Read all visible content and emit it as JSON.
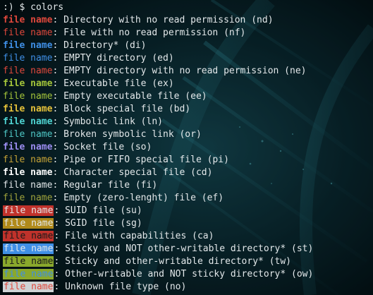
{
  "prompt": {
    "symbol": ":)",
    "dollar": "$",
    "command": "colors"
  },
  "entries": [
    {
      "name": "file name",
      "sep": ":",
      "desc": " Directory with no read permission (nd)",
      "fg": "#e0483c",
      "bg": "",
      "bold": true
    },
    {
      "name": "file name",
      "sep": ":",
      "desc": " File with no read permission (nf)",
      "fg": "#e0483c",
      "bg": "",
      "bold": false
    },
    {
      "name": "file name",
      "sep": ":",
      "desc": " Directory* (di)",
      "fg": "#3f8fe6",
      "bg": "",
      "bold": true
    },
    {
      "name": "file name",
      "sep": ":",
      "desc": " EMPTY directory (ed)",
      "fg": "#3f8fe6",
      "bg": "",
      "bold": false
    },
    {
      "name": "file name",
      "sep": ":",
      "desc": " EMPTY directory with no read permission (ne)",
      "fg": "#e0483c",
      "bg": "",
      "bold": false
    },
    {
      "name": "file name",
      "sep": ":",
      "desc": " Executable file (ex)",
      "fg": "#a4c53a",
      "bg": "",
      "bold": true
    },
    {
      "name": "file name",
      "sep": ":",
      "desc": " Empty executable file (ee)",
      "fg": "#a4c53a",
      "bg": "",
      "bold": false
    },
    {
      "name": "file name",
      "sep": ":",
      "desc": " Block special file (bd)",
      "fg": "#e6c23a",
      "bg": "",
      "bold": true
    },
    {
      "name": "file name",
      "sep": ":",
      "desc": " Symbolic link (ln)",
      "fg": "#4fd4d2",
      "bg": "",
      "bold": true
    },
    {
      "name": "file name",
      "sep": ":",
      "desc": " Broken symbolic link (or)",
      "fg": "#4fc8c6",
      "bg": "",
      "bold": false
    },
    {
      "name": "file name",
      "sep": ":",
      "desc": " Socket file (so)",
      "fg": "#9c8ef2",
      "bg": "",
      "bold": true
    },
    {
      "name": "file name",
      "sep": ":",
      "desc": " Pipe or FIFO special file (pi)",
      "fg": "#c7a437",
      "bg": "",
      "bold": false
    },
    {
      "name": "file name",
      "sep": ":",
      "desc": " Character special file (cd)",
      "fg": "#ffffff",
      "bg": "",
      "bold": true
    },
    {
      "name": "file name",
      "sep": ":",
      "desc": " Regular file (fi)",
      "fg": "#e3e8ea",
      "bg": "",
      "bold": false
    },
    {
      "name": "file name",
      "sep": ":",
      "desc": " Empty (zero-lenght) file (ef)",
      "fg": "#a0a43c",
      "bg": "",
      "bold": false
    },
    {
      "name": "file name",
      "sep": ":",
      "desc": " SUID file (su)",
      "fg": "#e3e8ea",
      "bg": "#c0322b",
      "bold": false
    },
    {
      "name": "file name",
      "sep": ":",
      "desc": " SGID file (sg)",
      "fg": "#e3e8ea",
      "bg": "#b08a1a",
      "bold": false
    },
    {
      "name": "file name",
      "sep": ":",
      "desc": " File with capabilities (ca)",
      "fg": "#1a1a1a",
      "bg": "#c0322b",
      "bold": false
    },
    {
      "name": "file name",
      "sep": ":",
      "desc": " Sticky and NOT other-writable directory* (st)",
      "fg": "#e3e8ea",
      "bg": "#3f8fe6",
      "bold": false
    },
    {
      "name": "file name",
      "sep": ":",
      "desc": " Sticky and other-writable directory* (tw)",
      "fg": "#1a1a1a",
      "bg": "#8aa82c",
      "bold": false
    },
    {
      "name": "file name",
      "sep": ":",
      "desc": " Other-writable and NOT sticky directory* (ow)",
      "fg": "#3f8fe6",
      "bg": "#8aa82c",
      "bold": false
    },
    {
      "name": "file name",
      "sep": ":",
      "desc": " Unknown file type (no)",
      "fg": "#e0483c",
      "bg": "#cfd3d5",
      "bold": false
    }
  ],
  "colors": {
    "text": "#e3e8ea",
    "background": "#041015",
    "accent_glow": "#1b6a78"
  }
}
